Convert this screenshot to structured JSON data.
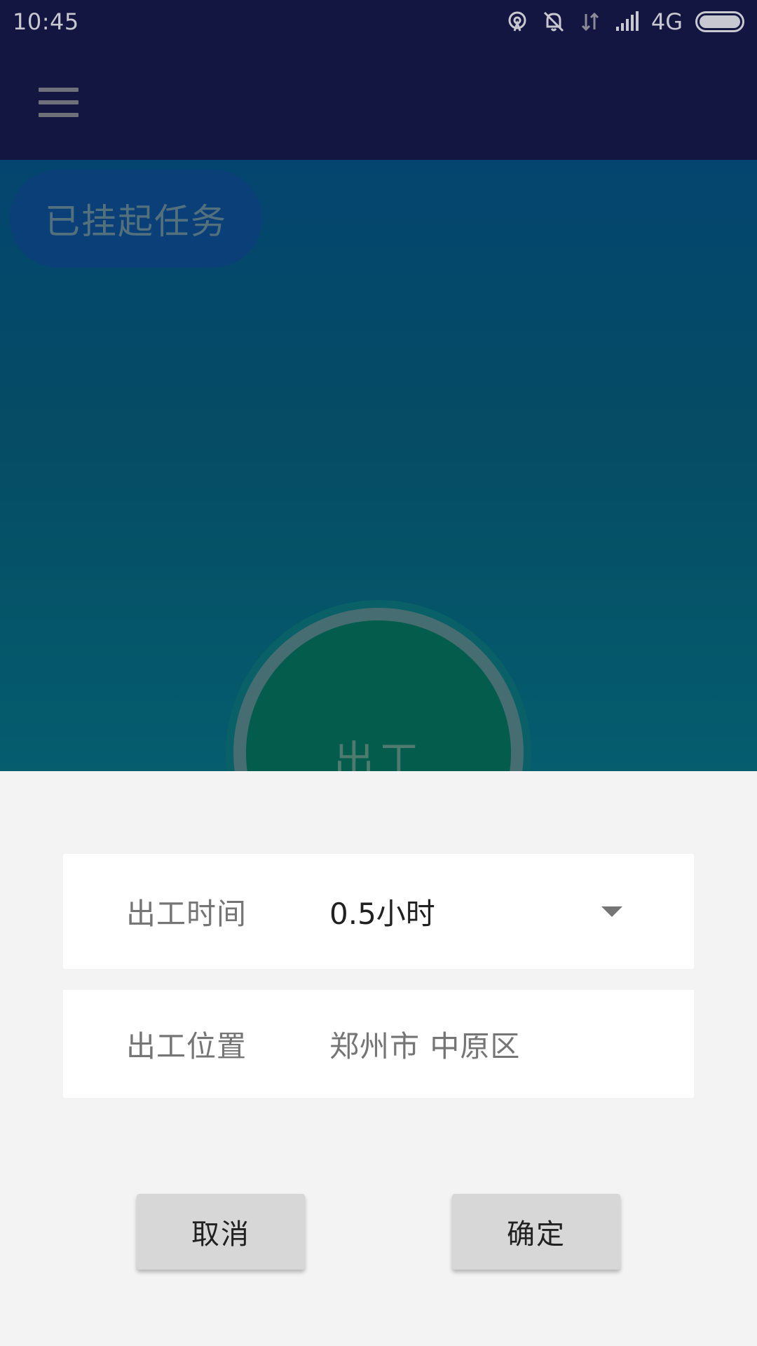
{
  "status_bar": {
    "time": "10:45",
    "network": "4G",
    "icons": [
      "hotspot-icon",
      "alarm-off-icon",
      "data-transfer-icon",
      "signal-icon",
      "battery-icon"
    ]
  },
  "toolbar": {
    "menu_icon": "hamburger-menu-icon"
  },
  "main": {
    "pending_tasks_label": "已挂起任务",
    "start_button_label": "出工"
  },
  "dialog": {
    "time_label": "出工时间",
    "time_value": "0.5小时",
    "location_label": "出工位置",
    "location_value": "郑州市 中原区",
    "cancel_label": "取消",
    "confirm_label": "确定"
  },
  "colors": {
    "status_bar_bg": "#121641",
    "main_gradient_top": "#04456f",
    "main_gradient_bottom": "#055d6e",
    "sheet_bg": "#f3f3f3",
    "button_bg": "#d7d7d7"
  }
}
